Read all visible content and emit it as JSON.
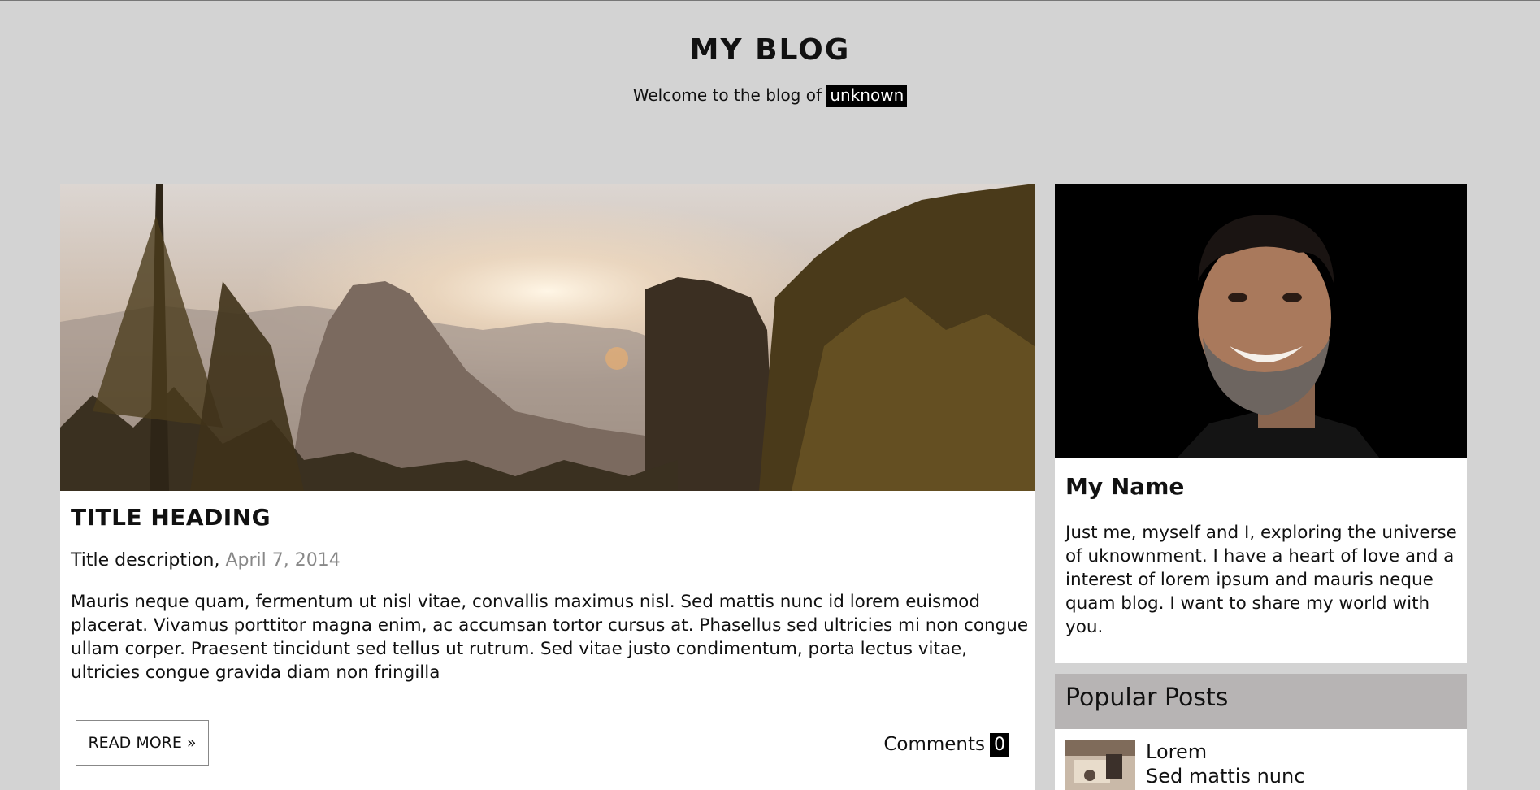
{
  "header": {
    "title": "MY BLOG",
    "welcome_prefix": "Welcome to the blog of",
    "owner": "unknown"
  },
  "post": {
    "title": "TITLE HEADING",
    "description": "Title description,",
    "date": "April 7, 2014",
    "body": "Mauris neque quam, fermentum ut nisl vitae, convallis maximus nisl. Sed mattis nunc id lorem euismod placerat. Vivamus porttitor magna enim, ac accumsan tortor cursus at. Phasellus sed ultricies mi non congue ullam corper. Praesent tincidunt sed tellus ut rutrum. Sed vitae justo condimentum, porta lectus vitae, ultricies congue gravida diam non fringilla",
    "read_more": "READ MORE »",
    "comments_label": "Comments",
    "comments_count": "0"
  },
  "profile": {
    "name": "My Name",
    "bio": "Just me, myself and I, exploring the universe of uknownment. I have a heart of love and a interest of lorem ipsum and mauris neque quam blog. I want to share my world with you."
  },
  "popular": {
    "heading": "Popular Posts",
    "items": [
      {
        "title": "Lorem",
        "subtitle": "Sed mattis nunc"
      }
    ]
  },
  "colors": {
    "page_bg": "#d3d3d3",
    "card_bg": "#ffffff",
    "popular_header_bg": "#b7b4b4",
    "date_color": "#888888"
  }
}
